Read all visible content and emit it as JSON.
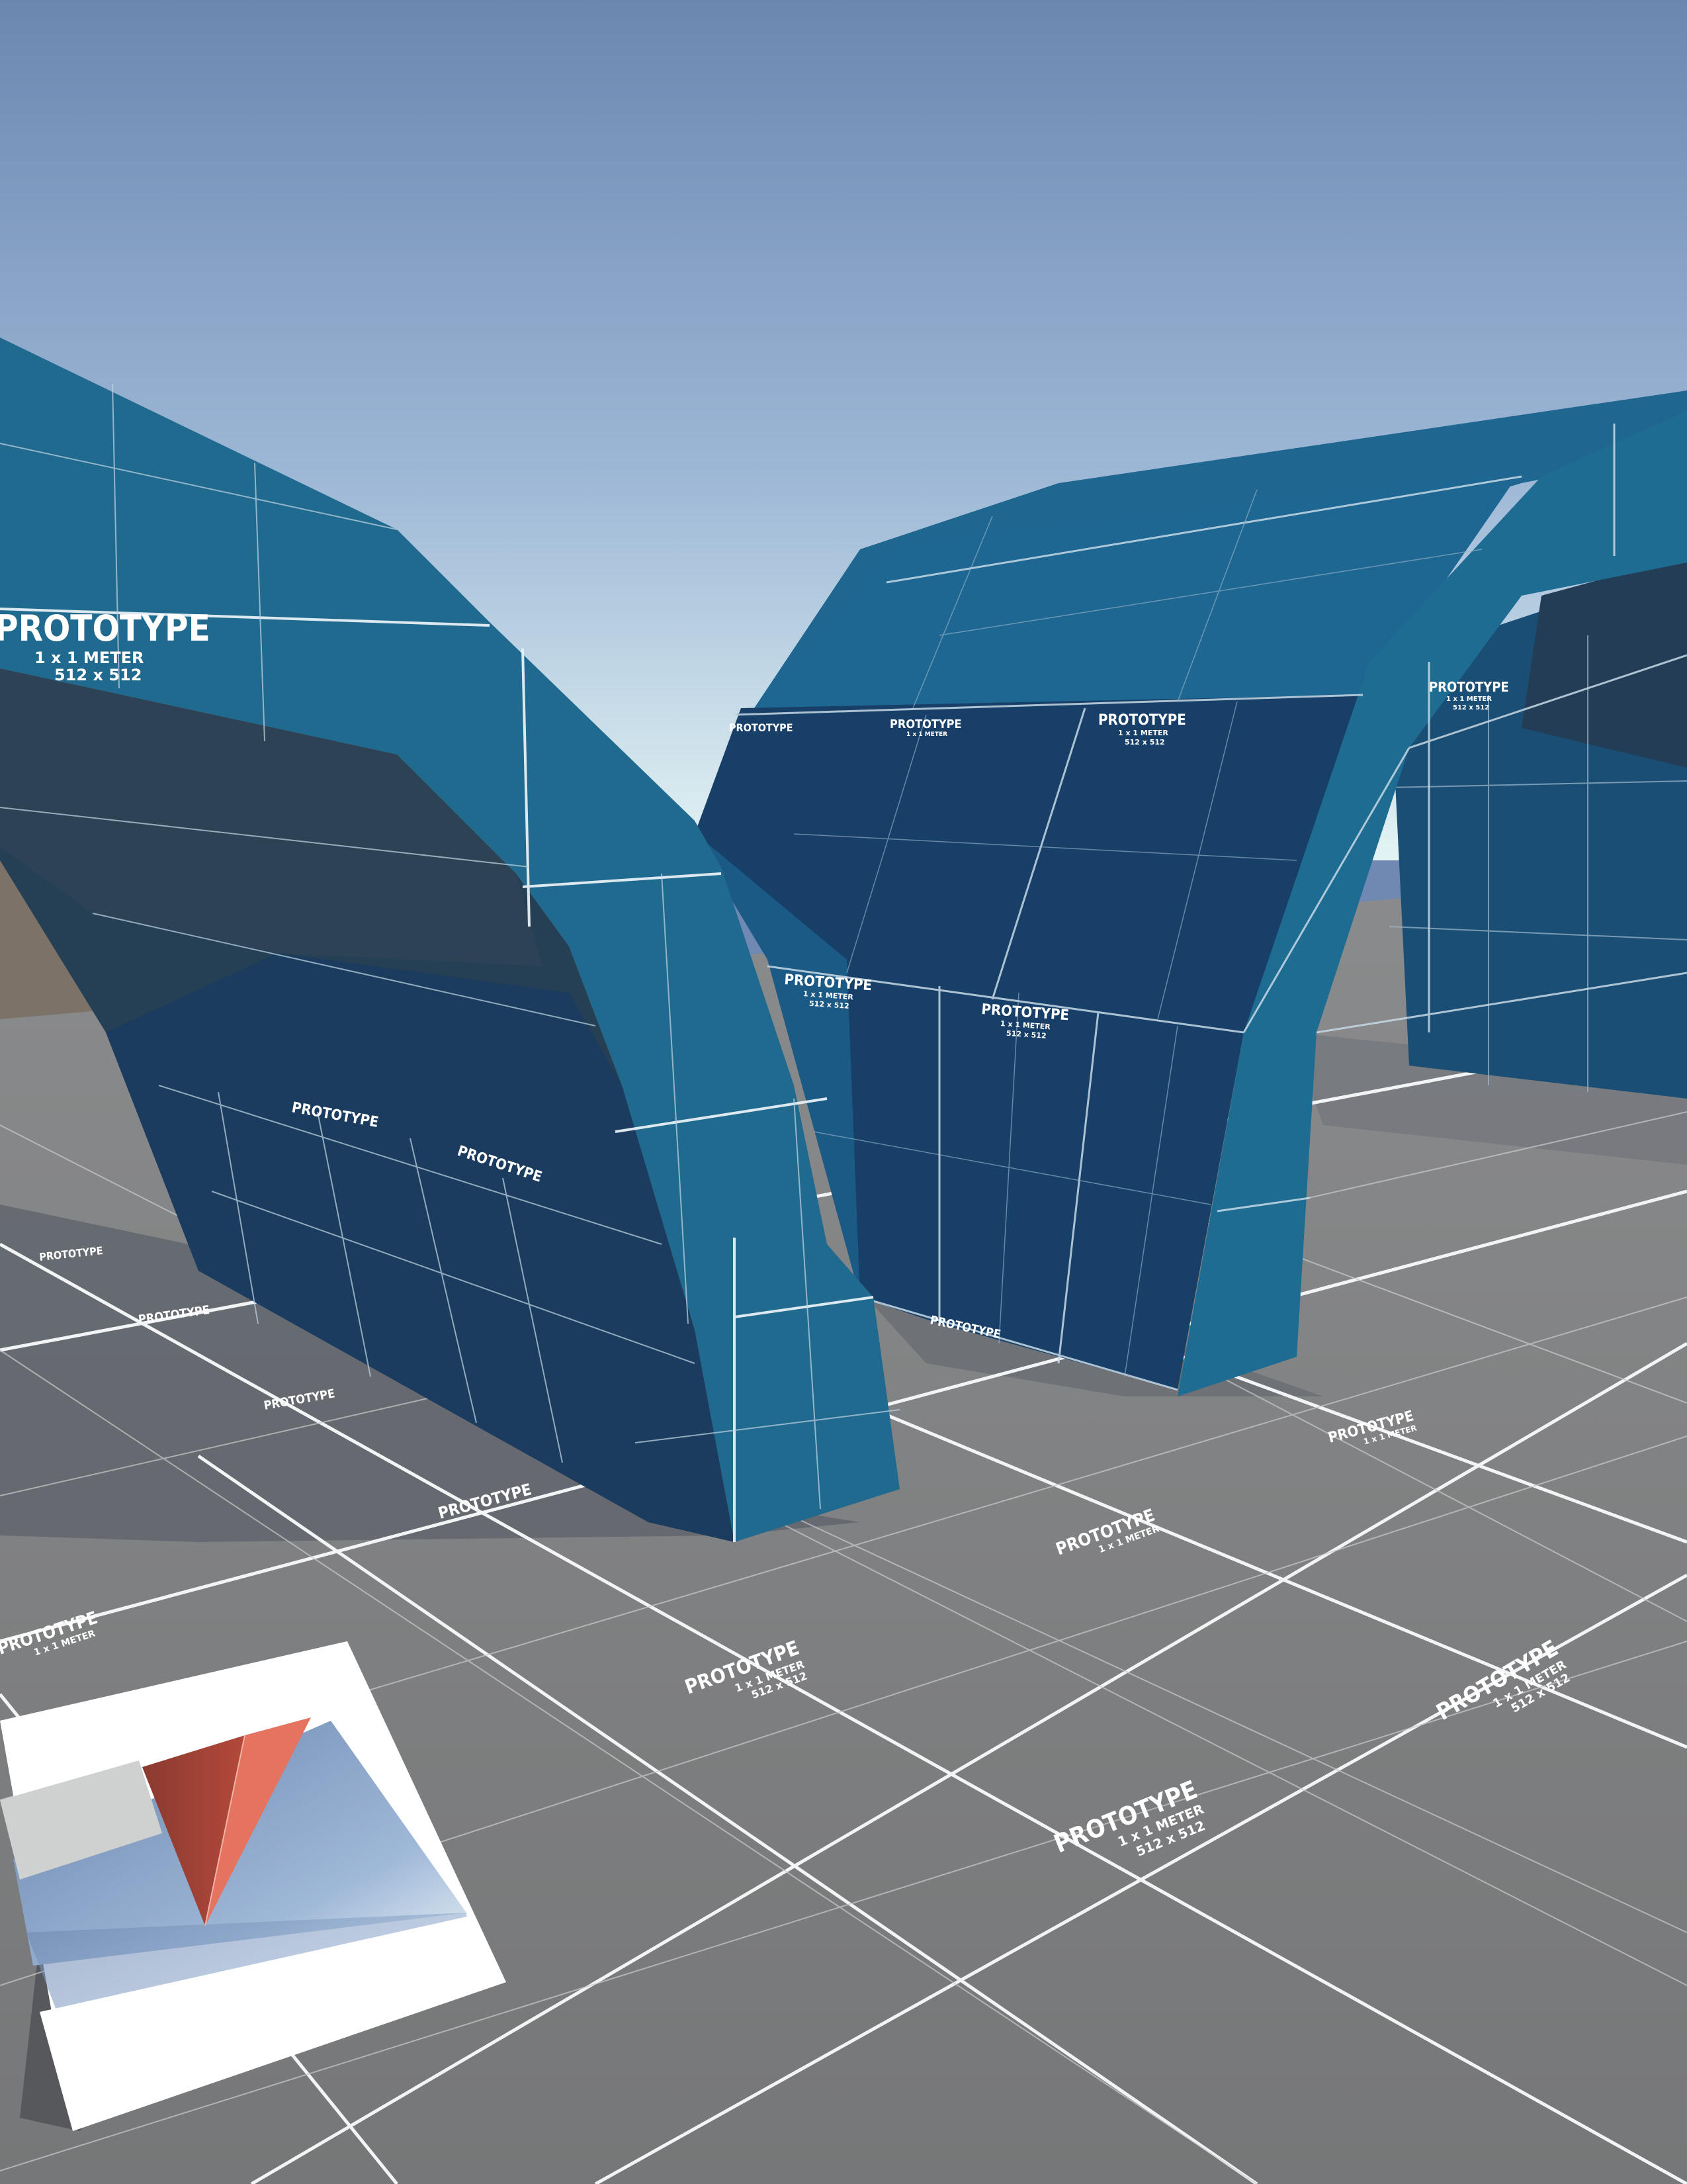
{
  "scene": {
    "texture_title": "PROTOTYPE",
    "texture_size_line": "1 x 1 METER",
    "texture_res_line": "512 x 512"
  },
  "colors": {
    "sky_top": "#6b87b0",
    "sky_horizon": "#dff1f3",
    "ground": "#7c7d7e",
    "ground_shadow": "#5c6169",
    "wall_light": "#206a8f",
    "wall_mid": "#1b5b84",
    "wall_dark": "#183f63",
    "wall_shade": "#244258",
    "grid_line": "#f2f4f6",
    "far_ground": "#7d7268",
    "panel_white": "#ffffff",
    "preview_red": "#e4745f",
    "preview_red_dark": "#8e3a2f",
    "preview_sky": "#8aa6c9"
  }
}
